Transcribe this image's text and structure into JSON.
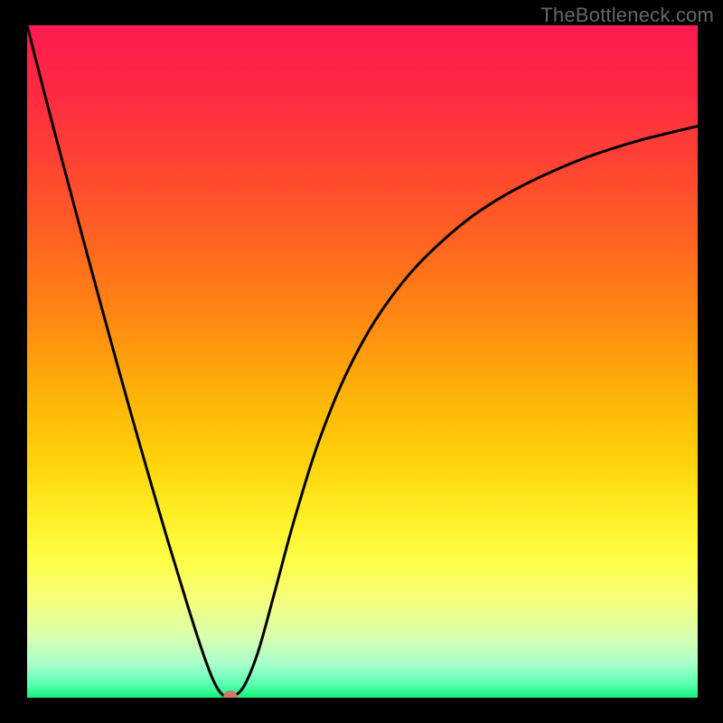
{
  "watermark": "TheBottleneck.com",
  "chart_data": {
    "type": "line",
    "title": "",
    "xlabel": "",
    "ylabel": "",
    "xlim": [
      0,
      1
    ],
    "ylim": [
      0,
      1
    ],
    "axes_visible": false,
    "grid": false,
    "background": "rainbow-gradient-red-to-green",
    "series": [
      {
        "name": "curve",
        "x": [
          0.0,
          0.03,
          0.06,
          0.09,
          0.12,
          0.15,
          0.18,
          0.21,
          0.24,
          0.26,
          0.275,
          0.285,
          0.293,
          0.3,
          0.31,
          0.325,
          0.345,
          0.37,
          0.4,
          0.44,
          0.49,
          0.55,
          0.62,
          0.7,
          0.8,
          0.9,
          1.0
        ],
        "y": [
          1.0,
          0.883,
          0.77,
          0.658,
          0.548,
          0.44,
          0.335,
          0.233,
          0.135,
          0.073,
          0.032,
          0.012,
          0.003,
          0.0,
          0.003,
          0.02,
          0.07,
          0.16,
          0.27,
          0.395,
          0.51,
          0.605,
          0.68,
          0.74,
          0.79,
          0.825,
          0.85
        ]
      }
    ],
    "marker": {
      "x": 0.303,
      "y": 0.0,
      "color": "#d07866",
      "radius_px": 8
    }
  }
}
